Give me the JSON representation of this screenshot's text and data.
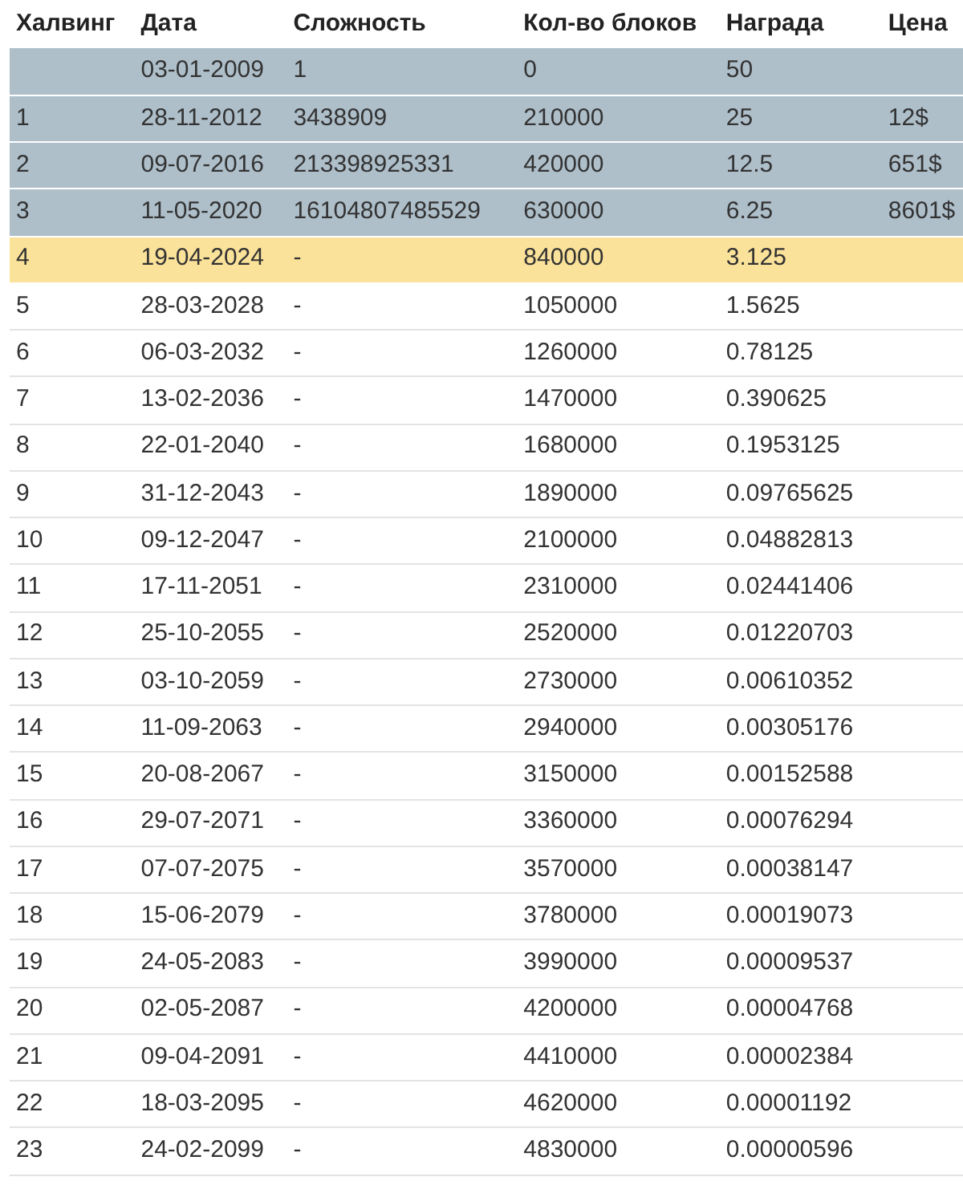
{
  "table": {
    "columns": [
      "Халвинг",
      "Дата",
      "Сложность",
      "Кол-во блоков",
      "Награда",
      "Цена"
    ],
    "rows": [
      {
        "kind": "past",
        "date": "03-01-2009",
        "difficulty": "1",
        "blocks": "0",
        "reward": "50"
      },
      {
        "kind": "past",
        "halving": "1",
        "date": "28-11-2012",
        "difficulty": "3438909",
        "blocks": "210000",
        "reward": "25",
        "price": "12$"
      },
      {
        "kind": "past",
        "halving": "2",
        "date": "09-07-2016",
        "difficulty": "213398925331",
        "blocks": "420000",
        "reward": "12.5",
        "price": "651$"
      },
      {
        "kind": "past",
        "halving": "3",
        "date": "11-05-2020",
        "difficulty": "16104807485529",
        "blocks": "630000",
        "reward": "6.25",
        "price": "8601$"
      },
      {
        "kind": "current",
        "halving": "4",
        "date": "19-04-2024",
        "difficulty": "-",
        "blocks": "840000",
        "reward": "3.125"
      },
      {
        "kind": "future",
        "halving": "5",
        "date": "28-03-2028",
        "difficulty": "-",
        "blocks": "1050000",
        "reward": "1.5625"
      },
      {
        "kind": "future",
        "halving": "6",
        "date": "06-03-2032",
        "difficulty": "-",
        "blocks": "1260000",
        "reward": "0.78125"
      },
      {
        "kind": "future",
        "halving": "7",
        "date": "13-02-2036",
        "difficulty": "-",
        "blocks": "1470000",
        "reward": "0.390625"
      },
      {
        "kind": "future",
        "halving": "8",
        "date": "22-01-2040",
        "difficulty": "-",
        "blocks": "1680000",
        "reward": "0.1953125"
      },
      {
        "kind": "future",
        "halving": "9",
        "date": "31-12-2043",
        "difficulty": "-",
        "blocks": "1890000",
        "reward": "0.09765625"
      },
      {
        "kind": "future",
        "halving": "10",
        "date": "09-12-2047",
        "difficulty": "-",
        "blocks": "2100000",
        "reward": "0.04882813"
      },
      {
        "kind": "future",
        "halving": "11",
        "date": "17-11-2051",
        "difficulty": "-",
        "blocks": "2310000",
        "reward": "0.02441406"
      },
      {
        "kind": "future",
        "halving": "12",
        "date": "25-10-2055",
        "difficulty": "-",
        "blocks": "2520000",
        "reward": "0.01220703"
      },
      {
        "kind": "future",
        "halving": "13",
        "date": "03-10-2059",
        "difficulty": "-",
        "blocks": "2730000",
        "reward": "0.00610352"
      },
      {
        "kind": "future",
        "halving": "14",
        "date": "11-09-2063",
        "difficulty": "-",
        "blocks": "2940000",
        "reward": "0.00305176"
      },
      {
        "kind": "future",
        "halving": "15",
        "date": "20-08-2067",
        "difficulty": "-",
        "blocks": "3150000",
        "reward": "0.00152588"
      },
      {
        "kind": "future",
        "halving": "16",
        "date": "29-07-2071",
        "difficulty": "-",
        "blocks": "3360000",
        "reward": "0.00076294"
      },
      {
        "kind": "future",
        "halving": "17",
        "date": "07-07-2075",
        "difficulty": "-",
        "blocks": "3570000",
        "reward": "0.00038147"
      },
      {
        "kind": "future",
        "halving": "18",
        "date": "15-06-2079",
        "difficulty": "-",
        "blocks": "3780000",
        "reward": "0.00019073"
      },
      {
        "kind": "future",
        "halving": "19",
        "date": "24-05-2083",
        "difficulty": "-",
        "blocks": "3990000",
        "reward": "0.00009537"
      },
      {
        "kind": "future",
        "halving": "20",
        "date": "02-05-2087",
        "difficulty": "-",
        "blocks": "4200000",
        "reward": "0.00004768"
      },
      {
        "kind": "future",
        "halving": "21",
        "date": "09-04-2091",
        "difficulty": "-",
        "blocks": "4410000",
        "reward": "0.00002384"
      },
      {
        "kind": "future",
        "halving": "22",
        "date": "18-03-2095",
        "difficulty": "-",
        "blocks": "4620000",
        "reward": "0.00001192"
      },
      {
        "kind": "future",
        "halving": "23",
        "date": "24-02-2099",
        "difficulty": "-",
        "blocks": "4830000",
        "reward": "0.00000596"
      }
    ]
  }
}
